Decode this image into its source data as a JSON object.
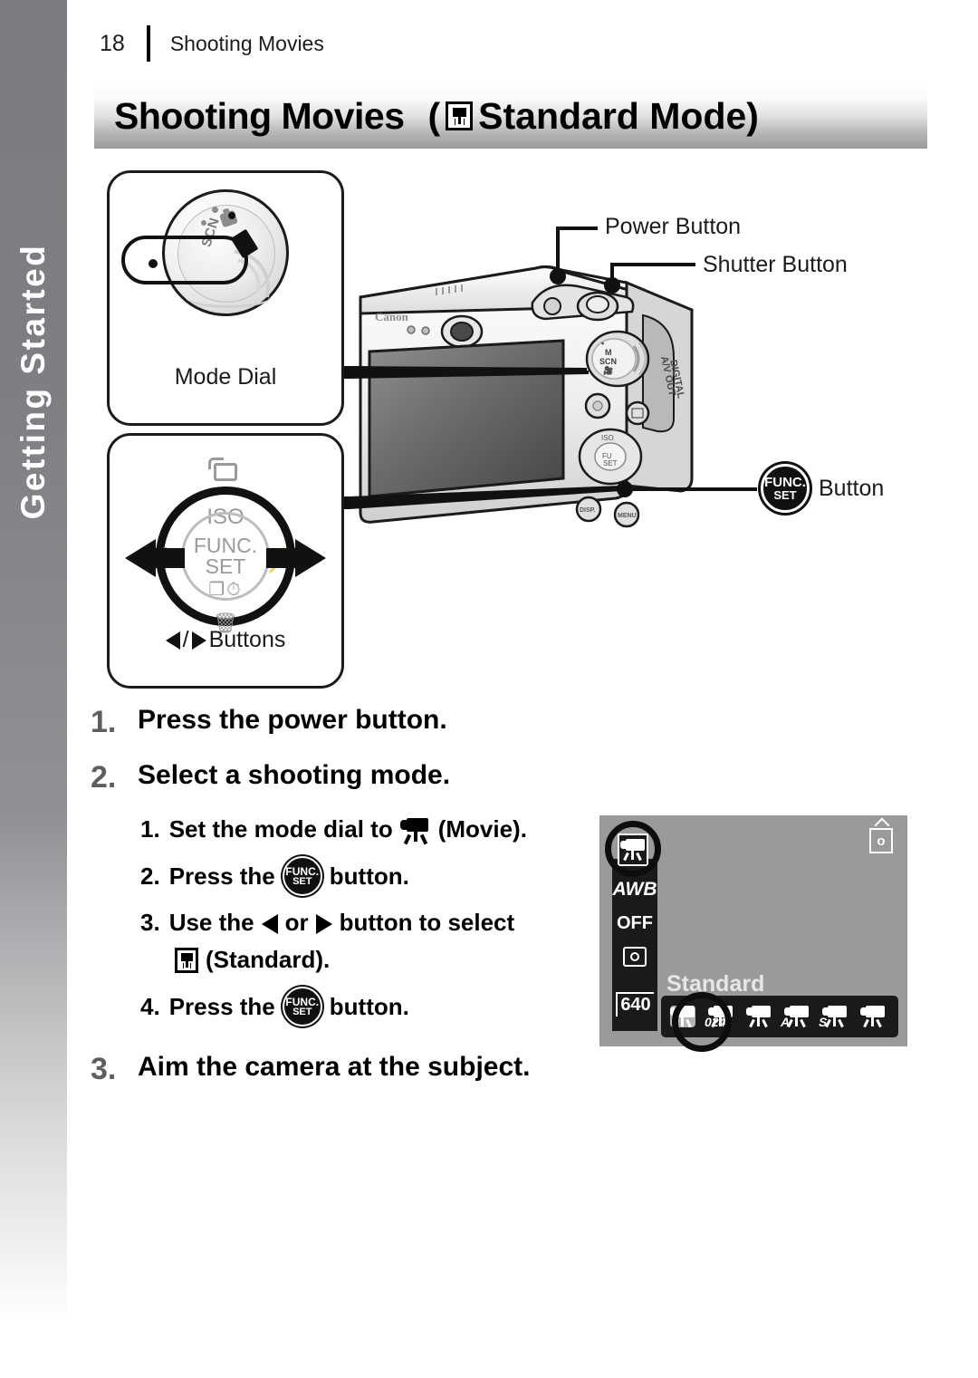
{
  "chapter_tab": {
    "label": "Getting Started"
  },
  "running_head": {
    "page_number": "18",
    "title": "Shooting Movies"
  },
  "title_banner": {
    "main": "Shooting Movies",
    "paren_open": "(",
    "mode_icon": "standard-movie-icon",
    "mode_text": "Standard Mode",
    "paren_close": ")"
  },
  "callout_boxes": [
    {
      "name": "mode-dial",
      "label": "Mode Dial",
      "dial_scn_text": "SCN"
    },
    {
      "name": "lr-buttons",
      "label_prefix": "",
      "label": "Buttons",
      "ring_center_line1": "FUNC.",
      "ring_center_line2": "SET",
      "ring_top": "ISO",
      "ring_flash": "⚡",
      "ring_macro": "❀",
      "ring_drive": "❐⏱",
      "ring_trash": "🗑"
    }
  ],
  "camera_callouts": [
    {
      "name": "power-button",
      "label": "Power Button"
    },
    {
      "name": "shutter-button",
      "label": "Shutter Button"
    },
    {
      "name": "funcset-button",
      "icon": "funcset-icon",
      "icon_line1": "FUNC.",
      "icon_line2": "SET",
      "label": "Button"
    }
  ],
  "steps": [
    {
      "num": "1.",
      "text": "Press the power button."
    },
    {
      "num": "2.",
      "text": "Select a shooting mode."
    },
    {
      "num": "3.",
      "text": "Aim the camera at the subject."
    }
  ],
  "substeps": [
    {
      "num": "1.",
      "pre": "Set the mode dial to",
      "icon": "movie-icon",
      "post": "(Movie)."
    },
    {
      "num": "2.",
      "pre": "Press the",
      "icon": "funcset-icon",
      "post": "button."
    },
    {
      "num": "3.",
      "pre": "Use the",
      "icon": "left-arrow-icon",
      "mid": "or",
      "icon2": "right-arrow-icon",
      "post": "button to select",
      "line2_icon": "standard-movie-icon",
      "line2_text": "(Standard)."
    },
    {
      "num": "4.",
      "pre": "Press the",
      "icon": "funcset-icon",
      "post": "button."
    }
  ],
  "funcset_icon": {
    "line1": "FUNC.",
    "line2": "SET"
  },
  "lcd_screen": {
    "white_balance": "AWB",
    "flash": "OFF",
    "metering": "evaluative-metering-icon",
    "resolution": "640",
    "protect_icon": "print-share-icon",
    "mode_label": "Standard",
    "mode_icons": [
      {
        "name": "standard-movie-mode",
        "selected": true,
        "tag": ""
      },
      {
        "name": "compact-movie-mode",
        "selected": false,
        "tag": "024"
      },
      {
        "name": "color-accent-movie-mode",
        "selected": false,
        "tag": ""
      },
      {
        "name": "color-swap-a-movie-mode",
        "selected": false,
        "tag": "A"
      },
      {
        "name": "color-swap-s-movie-mode",
        "selected": false,
        "tag": "S"
      },
      {
        "name": "special-movie-mode",
        "selected": false,
        "tag": ""
      }
    ]
  }
}
